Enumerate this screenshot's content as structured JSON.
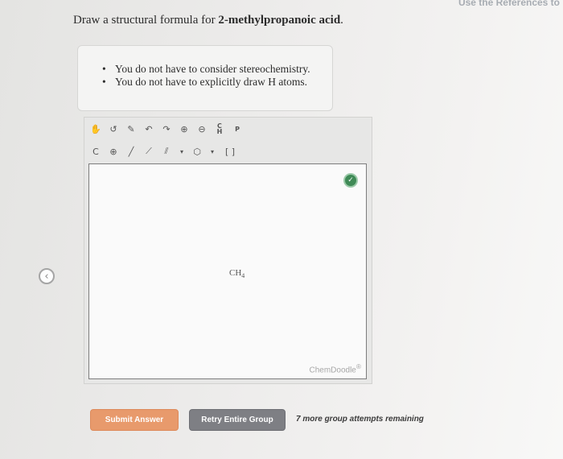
{
  "header": {
    "top_link": "Use the References to"
  },
  "question": {
    "prefix": "Draw a structural formula for ",
    "compound": "2-methylpropanoic acid",
    "suffix": "."
  },
  "hints": [
    "You do not have to consider stereochemistry.",
    "You do not have to explicitly draw H atoms."
  ],
  "toolbar": {
    "row1": [
      {
        "name": "hand-tool-icon",
        "glyph": "✋"
      },
      {
        "name": "lasso-icon",
        "glyph": "↺"
      },
      {
        "name": "eraser-icon",
        "glyph": "✎"
      },
      {
        "name": "undo-icon",
        "glyph": "↶"
      },
      {
        "name": "redo-icon",
        "glyph": "↷"
      },
      {
        "name": "zoom-in-icon",
        "glyph": "⊕"
      },
      {
        "name": "zoom-out-icon",
        "glyph": "⊖"
      },
      {
        "name": "templates-icon",
        "text": "C\nH"
      },
      {
        "name": "periodic-table-icon",
        "text": "P"
      }
    ],
    "row2": [
      {
        "name": "element-dropdown",
        "text": "C"
      },
      {
        "name": "charge-icon",
        "glyph": "⊕"
      },
      {
        "name": "single-bond-icon",
        "glyph": "╱"
      },
      {
        "name": "wedge-bond-icon",
        "glyph": "⟋"
      },
      {
        "name": "double-bond-icon",
        "glyph": "⫽"
      },
      {
        "name": "bond-dropdown-icon",
        "glyph": "▾"
      },
      {
        "name": "ring-icon",
        "glyph": "⬡"
      },
      {
        "name": "ring-dropdown-icon",
        "glyph": "▾"
      },
      {
        "name": "bracket-icon",
        "text": "[ ]"
      }
    ]
  },
  "canvas": {
    "atom_label": "CH",
    "atom_subscript": "4",
    "brand": "ChemDoodle",
    "brand_mark": "®"
  },
  "buttons": {
    "submit": "Submit Answer",
    "retry": "Retry Entire Group"
  },
  "attempts_text": "7 more group attempts remaining"
}
